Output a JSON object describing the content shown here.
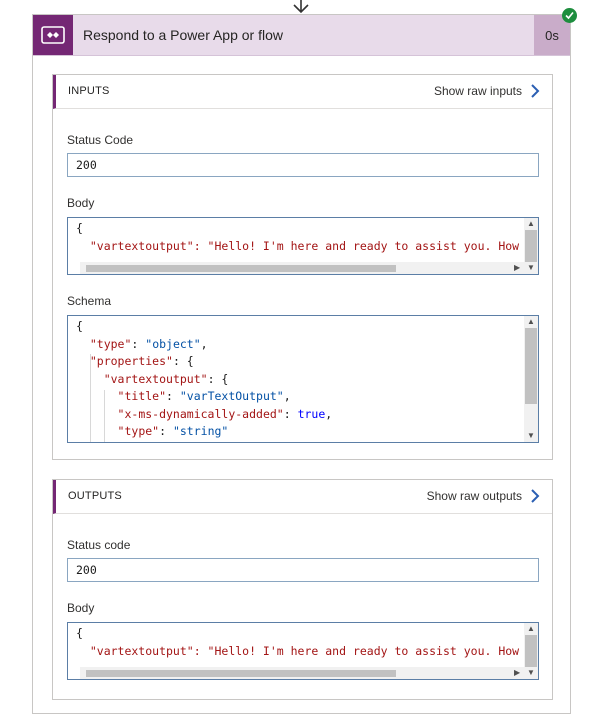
{
  "action": {
    "title": "Respond to a Power App or flow",
    "duration": "0s",
    "status": "succeeded",
    "icon": "power-apps-icon"
  },
  "inputs": {
    "title": "INPUTS",
    "raw_link": "Show raw inputs",
    "status_code_label": "Status Code",
    "status_code_value": "200",
    "body_label": "Body",
    "body_lines": [
      "{",
      "  \"vartextoutput\": \"Hello! I'm here and ready to assist you. How ca"
    ],
    "schema_label": "Schema",
    "schema_lines": [
      "{",
      "  \"type\": \"object\",",
      "  \"properties\": {",
      "    \"vartextoutput\": {",
      "      \"title\": \"varTextOutput\",",
      "      \"x-ms-dynamically-added\": true,",
      "      \"type\": \"string\""
    ]
  },
  "outputs": {
    "title": "OUTPUTS",
    "raw_link": "Show raw outputs",
    "status_code_label": "Status code",
    "status_code_value": "200",
    "body_label": "Body",
    "body_lines": [
      "{",
      "  \"vartextoutput\": \"Hello! I'm here and ready to assist you. How ca"
    ]
  },
  "colors": {
    "accent": "#742774",
    "header_bg": "#e8dbea",
    "success": "#1e8e3e",
    "link_chevron": "#2b5fb3"
  }
}
